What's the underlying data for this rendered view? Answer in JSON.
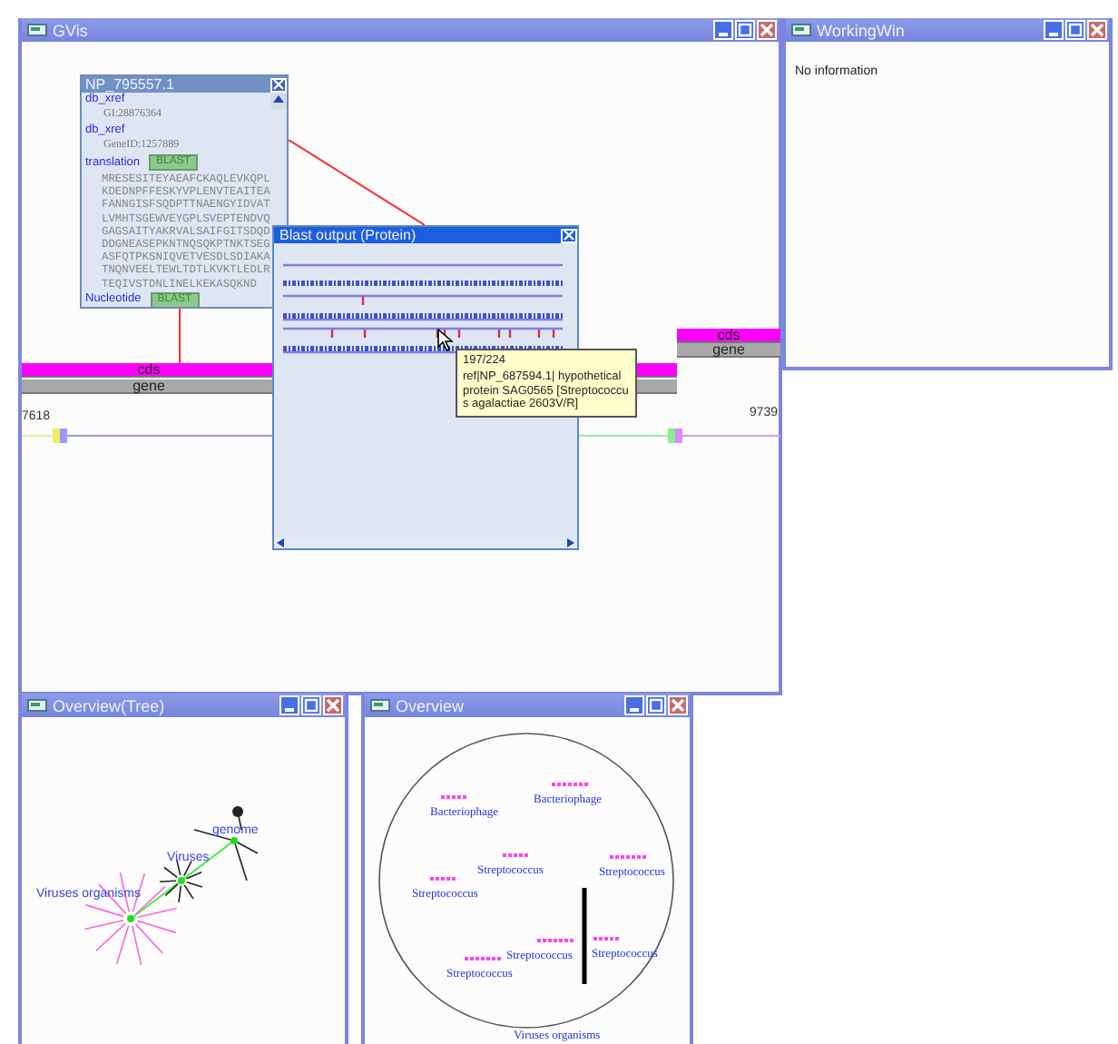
{
  "gvis": {
    "title": "GVis",
    "ruler": {
      "start": "7618",
      "end": "9739"
    },
    "tracks": [
      {
        "kind": "cds",
        "label": "cds"
      },
      {
        "kind": "gene",
        "label": "gene"
      },
      {
        "kind": "cds",
        "label": "cds"
      },
      {
        "kind": "gene",
        "label": "gene"
      }
    ],
    "feature_popup": {
      "title": "NP_795557.1",
      "lines": [
        {
          "kind": "key",
          "text": "db_xref"
        },
        {
          "kind": "value",
          "text": "GI:28876364"
        },
        {
          "kind": "key",
          "text": "db_xref"
        },
        {
          "kind": "value",
          "text": "GeneID:1257889"
        },
        {
          "kind": "key",
          "text": "translation",
          "button": "BLAST"
        },
        {
          "kind": "sequence",
          "text": "MRESESITEYAEAFCKAQLEVKQPLKDEDNPFFESKYVPLENVTEAITEAFANNGISFSQDPTTNAENGYIDVATLVMHTSGEWVEYGPLSVEPTENDVQGAGSAITYAKRVALSAIFGITSDQDDDGNEASEPKNTNQSQKPTNKTSEGASFQTPKSNIQVETVESDLSDIAKATNQNVEELTEWLTDTLKVKTLEDLRTEQIVSTDNLINELKEKASQKND"
        },
        {
          "kind": "key",
          "text": "Nucleotide",
          "button": "BLAST"
        }
      ]
    },
    "blast_window": {
      "title": "Blast output (Protein)"
    },
    "tooltip": {
      "score": "197/224",
      "description": "ref|NP_687594.1| hypothetical protein SAG0565 [Streptococcus agalactiae 2603V/R]"
    }
  },
  "working_win": {
    "title": "WorkingWin",
    "message": "No information"
  },
  "tree_window": {
    "title": "Overview(Tree)",
    "nodes": [
      "genome",
      "Viruses",
      "Viruses organisms"
    ]
  },
  "overview_window": {
    "title": "Overview",
    "labels": [
      "Bacteriophage",
      "Bacteriophage",
      "Streptococcus",
      "Streptococcus",
      "Streptococcus",
      "Streptococcus",
      "Streptococcus",
      "Streptococcus",
      "Viruses organisms"
    ]
  }
}
